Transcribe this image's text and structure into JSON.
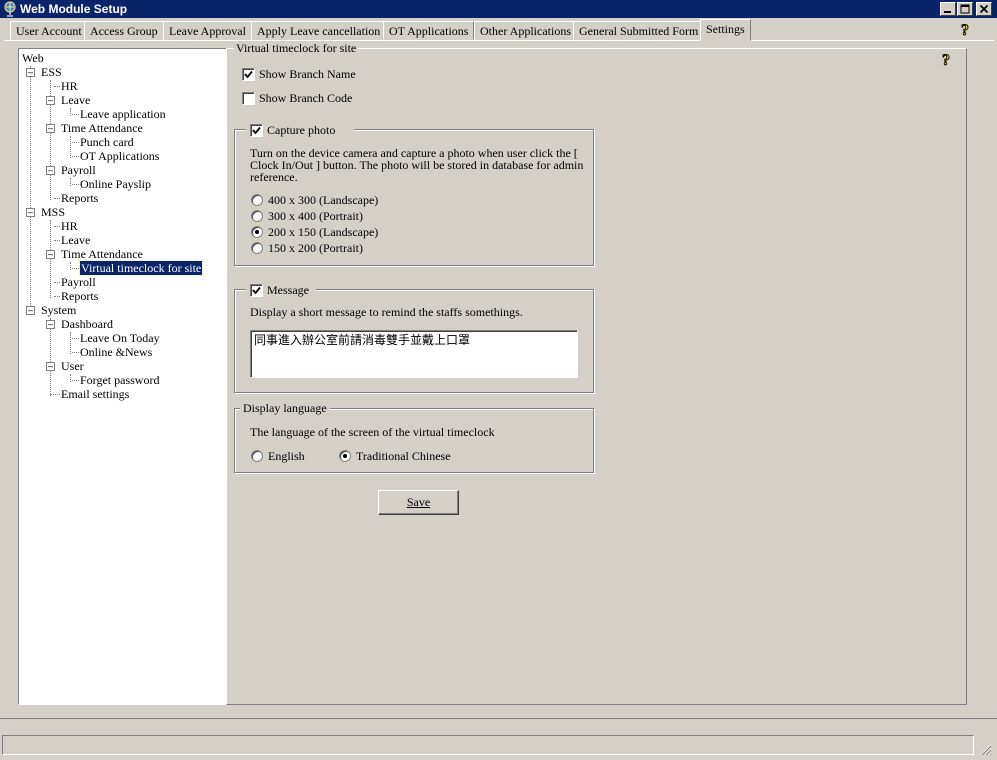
{
  "window": {
    "title": "Web Module Setup"
  },
  "tabs": [
    {
      "label": "User Account"
    },
    {
      "label": "Access Group"
    },
    {
      "label": "Leave Approval"
    },
    {
      "label": "Apply Leave cancellation"
    },
    {
      "label": "OT Applications"
    },
    {
      "label": "Other Applications"
    },
    {
      "label": "General Submitted Form"
    },
    {
      "label": "Settings"
    }
  ],
  "active_tab": "Settings",
  "tree": {
    "root": "Web",
    "ess": "ESS",
    "ess_hr": "HR",
    "ess_leave": "Leave",
    "ess_leave_app": "Leave application",
    "ess_ta": "Time Attendance",
    "ess_punch": "Punch card",
    "ess_ot": "OT Applications",
    "ess_payroll": "Payroll",
    "ess_payslip": "Online Payslip",
    "ess_reports": "Reports",
    "mss": "MSS",
    "mss_hr": "HR",
    "mss_leave": "Leave",
    "mss_ta": "Time Attendance",
    "mss_vtc": "Virtual timeclock for site",
    "mss_payroll": "Payroll",
    "mss_reports": "Reports",
    "system": "System",
    "sys_dashboard": "Dashboard",
    "sys_leave_today": "Leave On Today",
    "sys_news": "Online &News",
    "sys_user": "User",
    "sys_forgot": "Forget password",
    "sys_email": "Email settings",
    "selected": "Virtual timeclock for site"
  },
  "settings": {
    "section_title": "Virtual timeclock for site",
    "show_branch_name": {
      "label": "Show Branch Name",
      "checked": true
    },
    "show_branch_code": {
      "label": "Show Branch Code",
      "checked": false
    },
    "capture_photo": {
      "label": "Capture photo",
      "checked": true,
      "description_1": "Turn on the device camera and capture a photo when user click the [",
      "description_2": "Clock In/Out ] button. The photo will be stored in database for admin",
      "description_3": "reference.",
      "options": [
        "400 x 300 (Landscape)",
        "300 x 400 (Portrait)",
        "200 x 150 (Landscape)",
        "150 x 200 (Portrait)"
      ],
      "selected": "200 x 150 (Landscape)"
    },
    "message": {
      "label": "Message",
      "checked": true,
      "description": "Display a short message to remind the staffs somethings.",
      "value": "同事進入辦公室前請消毒雙手並戴上口罩"
    },
    "display_language": {
      "title": "Display language",
      "description": "The language of the screen of the virtual timeclock",
      "options": [
        "English",
        "Traditional Chinese"
      ],
      "selected": "Traditional Chinese"
    },
    "save_label": "Save"
  },
  "icons": {
    "help": "help-question-icon",
    "app": "globe-icon"
  },
  "colors": {
    "titlebar": "#0a246a",
    "face": "#d4d0c8",
    "selection": "#0a246a"
  }
}
